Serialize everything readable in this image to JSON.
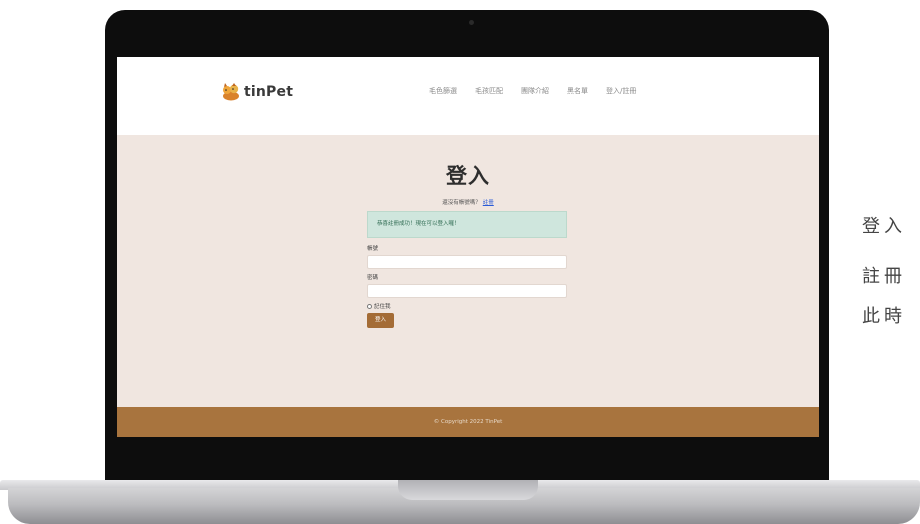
{
  "site": {
    "logo_text": "tinPet",
    "nav": [
      "毛色篩選",
      "毛孩匹配",
      "團隊介紹",
      "黑名單",
      "登入/註冊"
    ]
  },
  "login": {
    "title": "登入",
    "register_prompt": "還沒有帳號嗎？",
    "register_link": "註冊",
    "alert": "恭喜註冊成功！現在可以登入囉！",
    "account_label": "帳號",
    "password_label": "密碼",
    "remember_label": "記住我",
    "submit_label": "登入"
  },
  "footer": {
    "copyright": "© Copyright 2022 TinPet"
  },
  "side_caption": [
    "登入",
    "註冊",
    "此時"
  ],
  "colors": {
    "main_background": "#f0e6e0",
    "accent": "#a46c36",
    "footer": "#a8743e",
    "alert_background": "#cfe6dd",
    "link": "#2a5bd7"
  },
  "icons": {
    "logo": "pet-logo-icon"
  }
}
